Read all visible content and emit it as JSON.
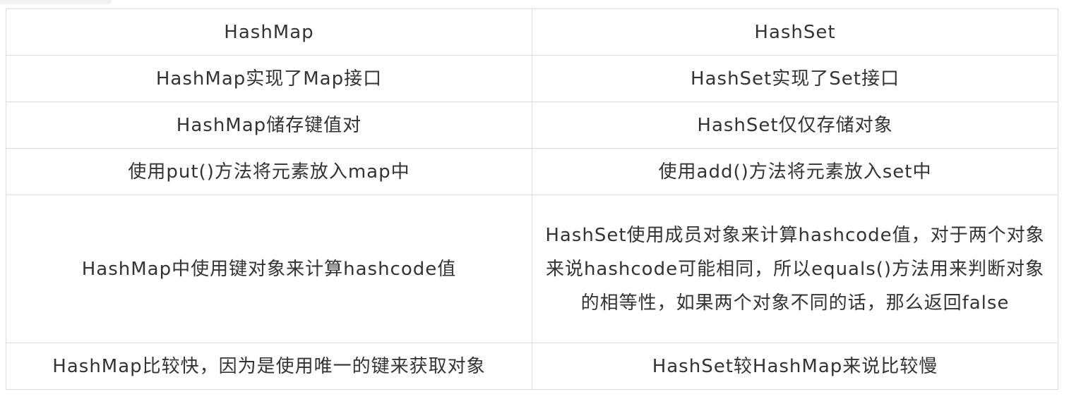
{
  "table": {
    "headers": [
      "HashMap",
      "HashSet"
    ],
    "rows": [
      [
        "HashMap实现了Map接口",
        "HashSet实现了Set接口"
      ],
      [
        "HashMap储存键值对",
        "HashSet仅仅存储对象"
      ],
      [
        "使用put()方法将元素放入map中",
        "使用add()方法将元素放入set中"
      ],
      [
        "HashMap中使用键对象来计算hashcode值",
        "HashSet使用成员对象来计算hashcode值，对于两个对象来说hashcode可能相同，所以equals()方法用来判断对象的相等性，如果两个对象不同的话，那么返回false"
      ],
      [
        "HashMap比较快，因为是使用唯一的键来获取对象",
        "HashSet较HashMap来说比较慢"
      ]
    ]
  }
}
